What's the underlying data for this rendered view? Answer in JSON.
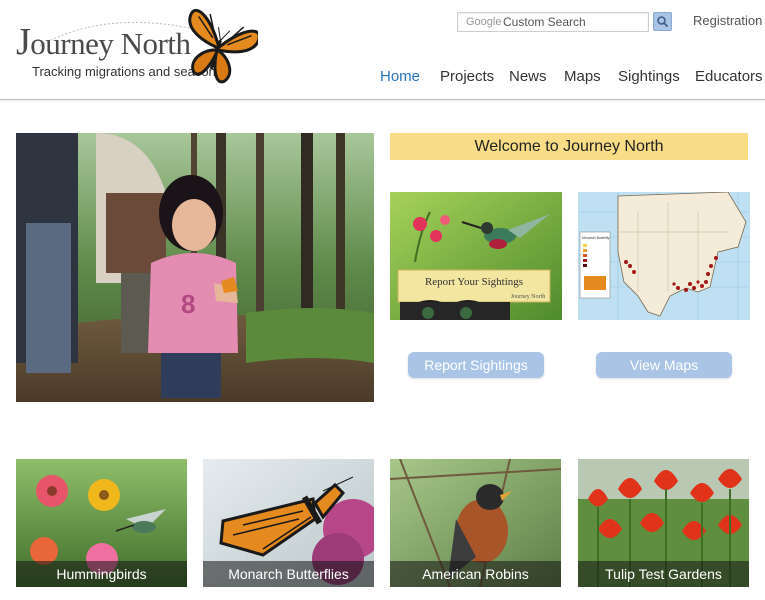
{
  "header": {
    "logo_title": "Journey North",
    "logo_j": "J",
    "logo_rest": "ourney North",
    "tagline": "Tracking migrations and seasons",
    "search": {
      "brand": "Google",
      "placeholder": "Custom Search"
    },
    "registration": "Registration",
    "nav": [
      {
        "label": "Home",
        "active": true
      },
      {
        "label": "Projects",
        "active": false
      },
      {
        "label": "News",
        "active": false
      },
      {
        "label": "Maps",
        "active": false
      },
      {
        "label": "Sightings",
        "active": false
      },
      {
        "label": "Educators",
        "active": false
      }
    ]
  },
  "main": {
    "welcome": "Welcome to Journey North",
    "report_card_title": "Report Your Sightings",
    "report_card_brand": "Journey North",
    "map_legend_title": "Monarch Butterfly",
    "report_button": "Report Sightings",
    "maps_button": "View Maps"
  },
  "tiles": [
    {
      "label": "Hummingbirds"
    },
    {
      "label": "Monarch Butterflies"
    },
    {
      "label": "American Robins"
    },
    {
      "label": "Tulip Test Gardens"
    }
  ],
  "colors": {
    "nav_active": "#2a74b8",
    "welcome_bg": "#f8dc86",
    "button_bg": "#a9c4e4"
  }
}
